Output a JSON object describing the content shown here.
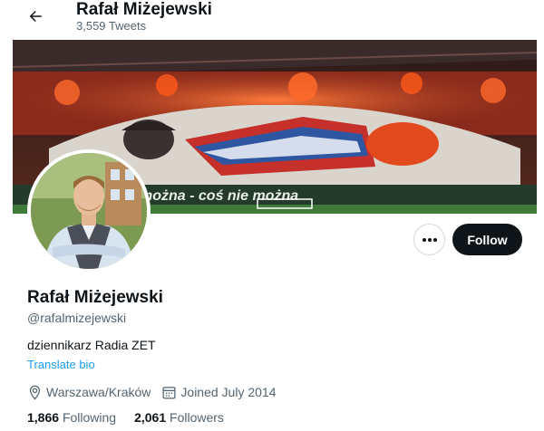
{
  "header": {
    "title": "Rafał Miżejewski",
    "tweet_count": "3,559 Tweets"
  },
  "profile": {
    "name": "Rafał Miżejewski",
    "handle": "@rafalmizejewski",
    "bio": "dziennikarz Radia ZET",
    "translate_label": "Translate bio",
    "location": "Warszawa/Kraków",
    "joined": "Joined July 2014",
    "following_count": "1,866",
    "following_label": "Following",
    "followers_count": "2,061",
    "followers_label": "Followers"
  },
  "actions": {
    "follow_label": "Follow",
    "more_icon": "ellipsis-icon"
  },
  "banner": {
    "banner_text": "można - coś nie można"
  },
  "colors": {
    "accent": "#1d9bf0",
    "follow_bg": "#0f1419",
    "secondary_text": "#536471"
  }
}
